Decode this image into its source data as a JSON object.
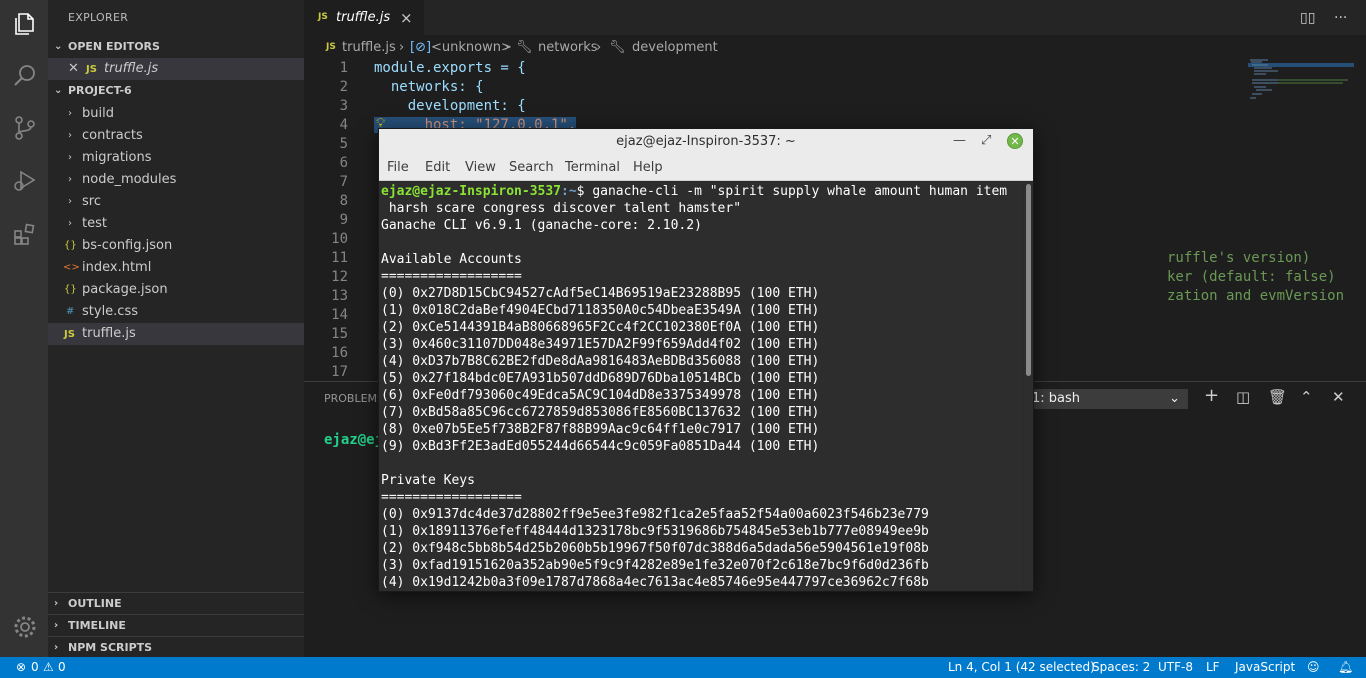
{
  "activity_bar": [
    "explorer-icon",
    "search-icon",
    "source-control-icon",
    "run-debug-icon",
    "extensions-icon",
    "manage-gear-icon"
  ],
  "sidebar": {
    "title": "EXPLORER",
    "open_editors": {
      "label": "OPEN EDITORS",
      "items": [
        {
          "badge": "JS",
          "name": "truffle.js"
        }
      ]
    },
    "project": {
      "label": "PROJECT-6",
      "folders": [
        "build",
        "contracts",
        "migrations",
        "node_modules",
        "src",
        "test"
      ],
      "files": [
        {
          "badge": "{}",
          "name": "bs-config.json"
        },
        {
          "badge": "<>",
          "name": "index.html"
        },
        {
          "badge": "{}",
          "name": "package.json"
        },
        {
          "badge": "#",
          "name": "style.css"
        },
        {
          "badge": "JS",
          "name": "truffle.js"
        }
      ]
    },
    "outline": "OUTLINE",
    "timeline": "TIMELINE",
    "npm_scripts": "NPM SCRIPTS"
  },
  "editor": {
    "tab": {
      "badge": "JS",
      "name": "truffle.js",
      "close": "×"
    },
    "breadcrumb": [
      "truffle.js",
      "<unknown>",
      "networks",
      "development"
    ],
    "line_numbers": [
      "1",
      "2",
      "3",
      "4",
      "5",
      "6",
      "7",
      "8",
      "9",
      "10",
      "11",
      "12",
      "13",
      "14",
      "15",
      "16",
      "17"
    ],
    "code": {
      "l1": "module.exports = {",
      "l2": "  networks: {",
      "l3": "    development: {",
      "l4": "      host: \"127.0.0.1\",",
      "l11_tail": "ruffle's version)",
      "l12_tail": "ker (default: false)",
      "l13_tail": "zation and evmVersion"
    }
  },
  "panel": {
    "tab_label": "PROBLEMS",
    "terminal_select": "1: bash",
    "prompt_fragment": "ejaz@ej"
  },
  "terminal_window": {
    "title": "ejaz@ejaz-Inspiron-3537: ~",
    "menu": [
      "File",
      "Edit",
      "View",
      "Search",
      "Terminal",
      "Help"
    ],
    "prompt_user": "ejaz@ejaz-Inspiron-3537",
    "prompt_path": ":~",
    "command": "$ ganache-cli -m \"spirit supply whale amount human item",
    "command_cont": " harsh scare congress discover talent hamster\"",
    "version": "Ganache CLI v6.9.1 (ganache-core: 2.10.2)",
    "accounts_header": "Available Accounts",
    "separator": "==================",
    "accounts": [
      "(0) 0x27D8D15CbC94527cAdf5eC14B69519aE23288B95 (100 ETH)",
      "(1) 0x018C2daBef4904ECbd7118350A0c54DbeaE3549A (100 ETH)",
      "(2) 0xCe5144391B4aB80668965F2Cc4f2CC102380Ef0A (100 ETH)",
      "(3) 0x460c31107DD048e34971E57DA2F99f659Add4f02 (100 ETH)",
      "(4) 0xD37b7B8C62BE2fdDe8dAa9816483AeBDBd356088 (100 ETH)",
      "(5) 0x27f184bdc0E7A931b507ddD689D76Dba10514BCb (100 ETH)",
      "(6) 0xFe0df793060c49Edca5AC9C104dD8e3375349978 (100 ETH)",
      "(7) 0xBd58a85C96cc6727859d853086fE8560BC137632 (100 ETH)",
      "(8) 0xe07b5Ee5f738B2F87f88B99Aac9c64ff1e0c7917 (100 ETH)",
      "(9) 0xBd3Ff2E3adEd055244d66544c9c059Fa0851Da44 (100 ETH)"
    ],
    "keys_header": "Private Keys",
    "keys": [
      "(0) 0x9137dc4de37d28802ff9e5ee3fe982f1ca2e5faa52f54a00a6023f546b23e779",
      "(1) 0x18911376efeff48444d1323178bc9f5319686b754845e53eb1b777e08949ee9b",
      "(2) 0xf948c5bb8b54d25b2060b5b19967f50f07dc388d6a5dada56e5904561e19f08b",
      "(3) 0xfad19151620a352ab90e5f9c9f4282e89e1fe32e070f2c618e7bc9f6d0d236fb",
      "(4) 0x19d1242b0a3f09e1787d7868a4ec7613ac4e85746e95e447797ce36962c7f68b"
    ]
  },
  "status_bar": {
    "errors": "0",
    "warnings": "0",
    "position": "Ln 4, Col 1 (42 selected)",
    "spaces": "Spaces: 2",
    "encoding": "UTF-8",
    "eol": "LF",
    "language": "JavaScript"
  }
}
